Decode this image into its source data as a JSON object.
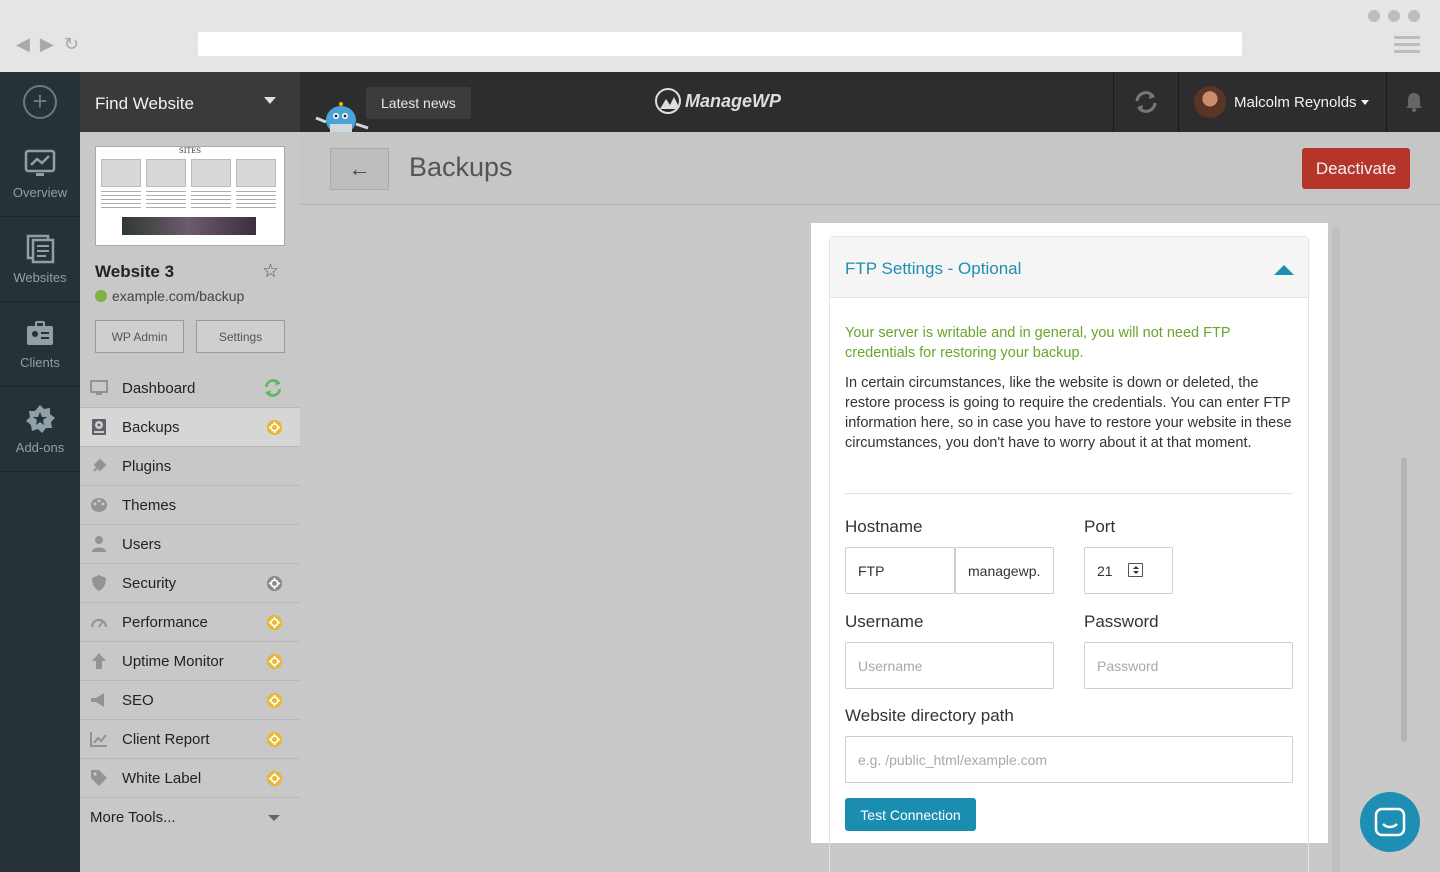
{
  "topbar": {
    "find_website": "Find Website",
    "latest_news": "Latest news",
    "logo": "ManageWP",
    "user_name": "Malcolm Reynolds"
  },
  "rail": {
    "items": [
      {
        "label": "Overview",
        "icon": "chart-monitor-icon"
      },
      {
        "label": "Websites",
        "icon": "websites-stack-icon"
      },
      {
        "label": "Clients",
        "icon": "clients-badge-icon"
      },
      {
        "label": "Add-ons",
        "icon": "star-badge-icon"
      }
    ]
  },
  "site": {
    "thumb_title": "SITES",
    "name": "Website 3",
    "url": "example.com/backup",
    "wp_admin": "WP Admin",
    "settings": "Settings"
  },
  "menu": {
    "items": [
      {
        "label": "Dashboard",
        "icon": "monitor-icon",
        "badge": "refresh-icon"
      },
      {
        "label": "Backups",
        "icon": "backup-drive-icon",
        "badge": "gear-icon"
      },
      {
        "label": "Plugins",
        "icon": "plug-icon",
        "badge": ""
      },
      {
        "label": "Themes",
        "icon": "palette-icon",
        "badge": ""
      },
      {
        "label": "Users",
        "icon": "user-icon",
        "badge": ""
      },
      {
        "label": "Security",
        "icon": "shield-icon",
        "badge": "gear-icon"
      },
      {
        "label": "Performance",
        "icon": "gauge-icon",
        "badge": "gear-icon"
      },
      {
        "label": "Uptime Monitor",
        "icon": "arrow-up-icon",
        "badge": "gear-icon"
      },
      {
        "label": "SEO",
        "icon": "megaphone-icon",
        "badge": "gear-icon"
      },
      {
        "label": "Client Report",
        "icon": "report-chart-icon",
        "badge": "gear-icon"
      },
      {
        "label": "White Label",
        "icon": "tag-icon",
        "badge": "gear-icon"
      }
    ],
    "more": "More Tools..."
  },
  "main": {
    "title": "Backups",
    "deactivate": "Deactivate"
  },
  "ftp": {
    "heading": "FTP Settings - Optional",
    "writable_notice": "Your server is writable and in general, you will not need FTP credentials for restoring your backup.",
    "info": "In certain circumstances, like the website is down or deleted, the restore process is going to require the credentials. You can enter FTP information here, so in case you have to restore your website in these circumstances, you don't have to worry about it at that moment.",
    "hostname_label": "Hostname",
    "protocol_value": "FTP",
    "hostname_value": "managewp.",
    "port_label": "Port",
    "port_value": "21",
    "username_label": "Username",
    "username_placeholder": "Username",
    "password_label": "Password",
    "password_placeholder": "Password",
    "path_label": "Website directory path",
    "path_placeholder": "e.g. /public_html/example.com",
    "test_button": "Test Connection"
  },
  "colors": {
    "accent": "#1f8fb0",
    "danger": "#b6352b",
    "success": "#6aa52c",
    "rail": "#263238"
  }
}
